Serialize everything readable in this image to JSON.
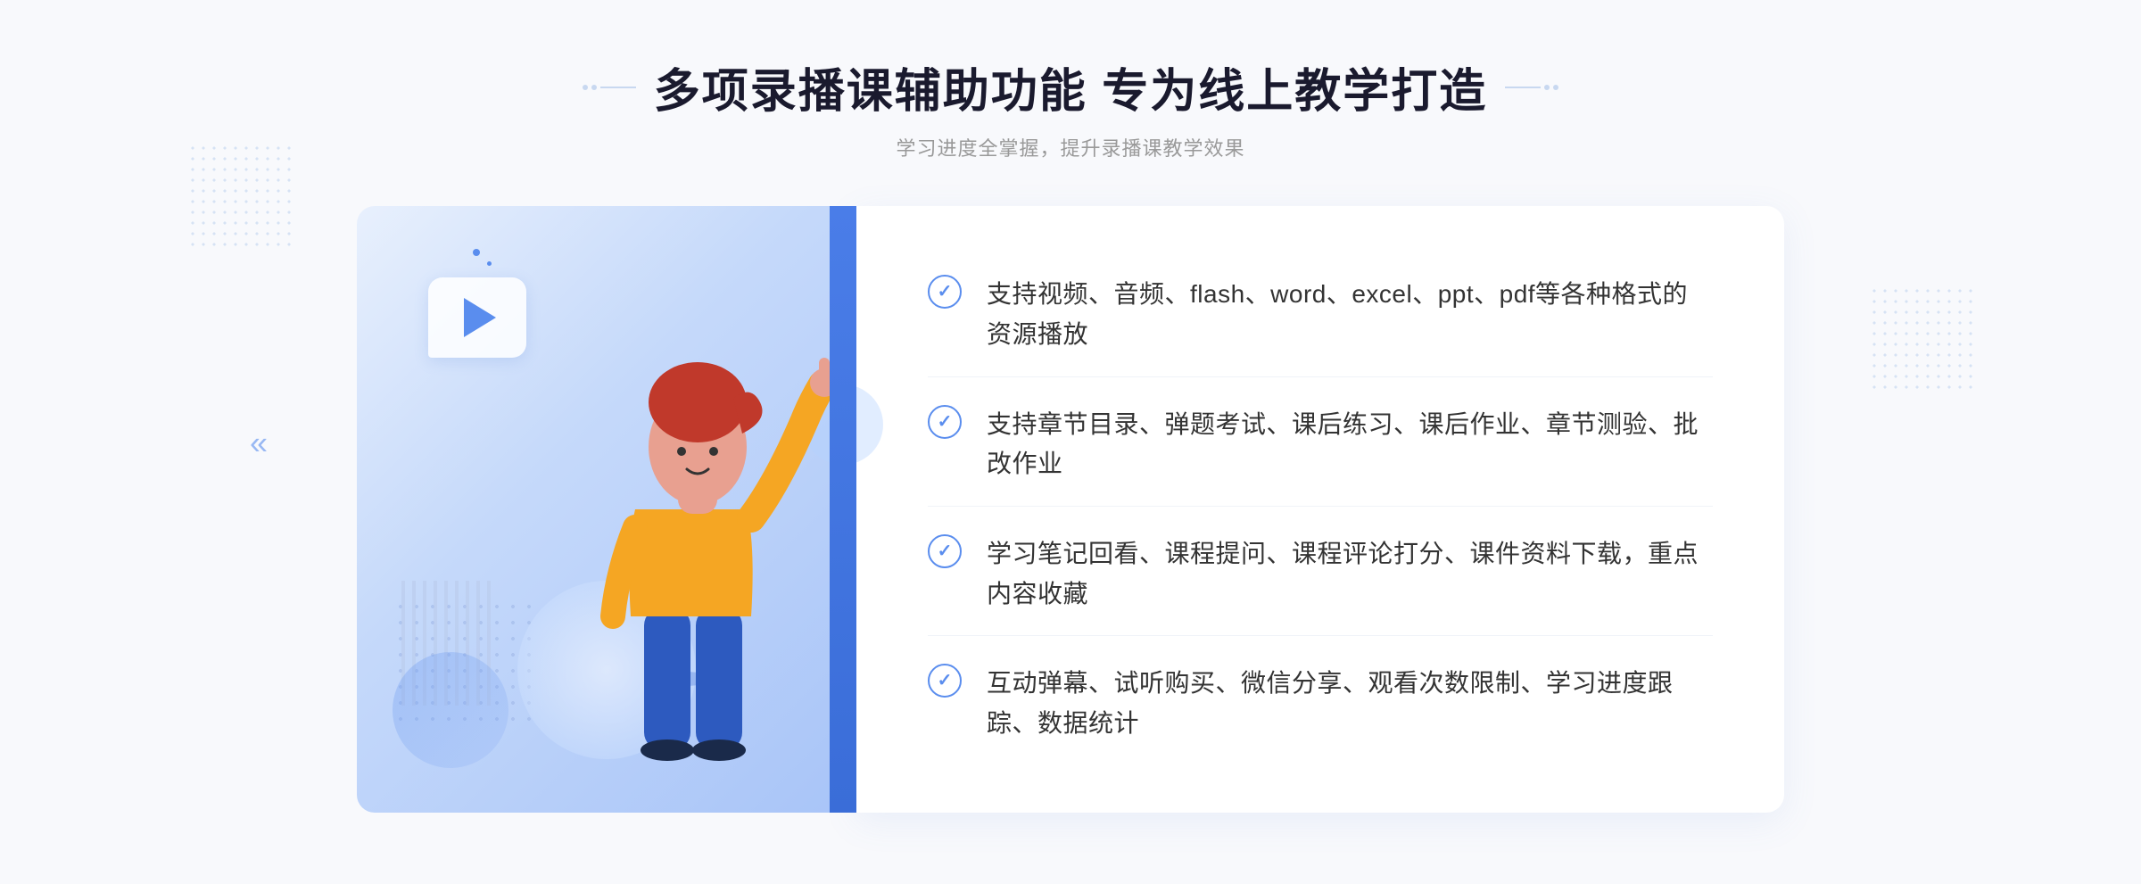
{
  "header": {
    "title": "多项录播课辅助功能 专为线上教学打造",
    "subtitle": "学习进度全掌握，提升录播课教学效果"
  },
  "features": [
    {
      "id": "feature-1",
      "text": "支持视频、音频、flash、word、excel、ppt、pdf等各种格式的资源播放"
    },
    {
      "id": "feature-2",
      "text": "支持章节目录、弹题考试、课后练习、课后作业、章节测验、批改作业"
    },
    {
      "id": "feature-3",
      "text": "学习笔记回看、课程提问、课程评论打分、课件资料下载，重点内容收藏"
    },
    {
      "id": "feature-4",
      "text": "互动弹幕、试听购买、微信分享、观看次数限制、学习进度跟踪、数据统计"
    }
  ],
  "icons": {
    "check": "✓",
    "play": "▶",
    "chevron_left": "«"
  },
  "colors": {
    "primary": "#5a8dee",
    "title": "#1a1a2e",
    "text": "#333333",
    "subtitle": "#999999",
    "light_blue": "#e8f0fd"
  }
}
